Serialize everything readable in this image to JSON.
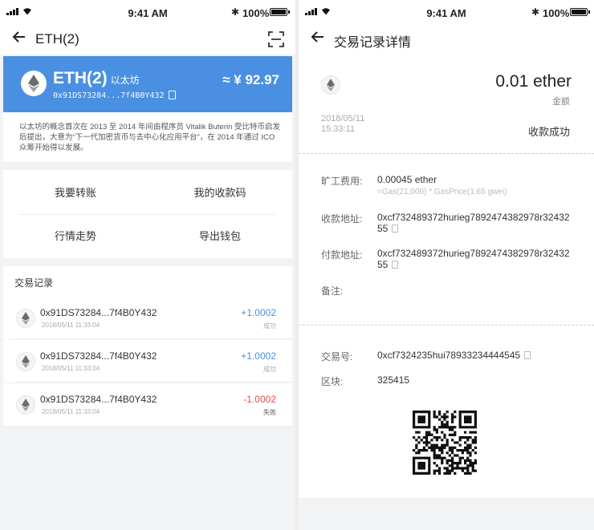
{
  "status_bar": {
    "time": "9:41 AM",
    "battery": "100%"
  },
  "left": {
    "nav": {
      "title": "ETH(2)"
    },
    "wallet": {
      "coin": "ETH(2)",
      "coin_cn": "以太坊",
      "address": "0x91DS73284...7f4B0Y432",
      "value": "≈ ¥ 92.97"
    },
    "description": "以太坊的概念首次在 2013 至 2014 年间由程序员 Vitalik Buterin 受比特币启发后提出，大意为“下一代加密货币与去中心化应用平台”，在 2014 年通过 ICO 众筹开始得以发展。",
    "actions": [
      "我要转账",
      "我的收款码",
      "行情走势",
      "导出钱包"
    ],
    "records_title": "交易记录",
    "records": [
      {
        "address": "0x91DS73284...7f4B0Y432",
        "date": "2018/05/11 11:33:04",
        "amount": "+1.0002",
        "status": "成功"
      },
      {
        "address": "0x91DS73284...7f4B0Y432",
        "date": "2018/05/11 11:33:04",
        "amount": "+1.0002",
        "status": "成功"
      },
      {
        "address": "0x91DS73284...7f4B0Y432",
        "date": "2018/05/11 11:33:04",
        "amount": "-1.0002",
        "status": "失败"
      }
    ]
  },
  "right": {
    "nav": {
      "title": "交易记录详情"
    },
    "amount": "0.01 ether",
    "amount_label": "金额",
    "date": "2018/05/11",
    "time": "15:33:11",
    "status": "收款成功",
    "fee_label": "旷工费用:",
    "fee": "0.00045 ether",
    "fee_detail": "=Gas(21,000) * GasPrice(1.65 gwei)",
    "to_label": "收款地址:",
    "to_address": "0xcf732489372hurieg7892474382978r3243255",
    "from_label": "付款地址:",
    "from_address": "0xcf732489372hurieg7892474382978r3243255",
    "note_label": "备注:",
    "txid_label": "交易号:",
    "txid": "0xcf7324235hui78933234444545",
    "block_label": "区块:",
    "block": "325415"
  },
  "colors": {
    "primary": "#4a90e2",
    "positive": "#4a90e2",
    "negative": "#e94a4a"
  }
}
